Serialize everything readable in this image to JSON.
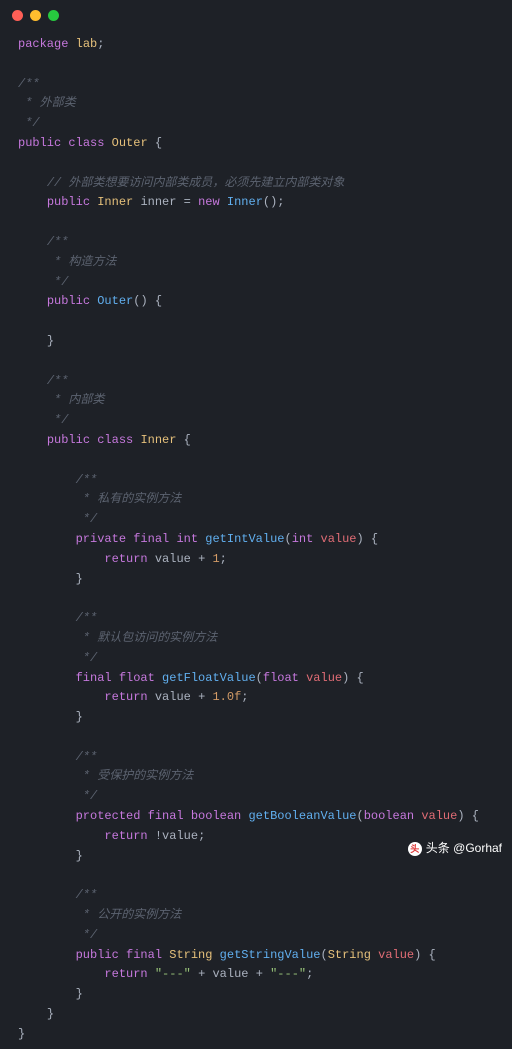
{
  "c": {
    "sc": ";",
    "ob": "{",
    "cb": "}",
    "op": "(",
    "eq": "=",
    "pl": "+",
    "ret": "return",
    "l0": {
      "a": "package",
      "b": "lab"
    },
    "c1": {
      "a": "/**",
      "b": " * 外部类",
      "c": " */"
    },
    "l1": {
      "a": "public",
      "b": "class",
      "c": "Outer"
    },
    "c2": "// 外部类想要访问内部类成员，必须先建立内部类对象",
    "l2": {
      "a": "public",
      "b": "Inner",
      "c": "inner",
      "d": "new",
      "e": "Inner",
      "f": "();"
    },
    "c3": {
      "a": "/**",
      "b": " * 构造方法",
      "c": " */"
    },
    "l3": {
      "a": "public",
      "b": "Outer",
      "c": "() {"
    },
    "c4": {
      "a": "/**",
      "b": " * 内部类",
      "c": " */"
    },
    "l4": {
      "a": "public",
      "b": "class",
      "c": "Inner"
    },
    "c5": {
      "a": "/**",
      "b": " * 私有的实例方法",
      "c": " */"
    },
    "l5": {
      "a": "private",
      "b": "final",
      "c": "int",
      "d": "getIntValue",
      "e": "int",
      "f": "value",
      "g": ") {",
      "h": "value",
      "i": "1"
    },
    "c6": {
      "a": "/**",
      "b": " * 默认包访问的实例方法",
      "c": " */"
    },
    "l6": {
      "a": "final",
      "b": "float",
      "c": "getFloatValue",
      "d": "float",
      "e": "value",
      "f": ") {",
      "g": "value",
      "h": "1.0f"
    },
    "c7": {
      "a": "/**",
      "b": " * 受保护的实例方法",
      "c": " */"
    },
    "l7": {
      "a": "protected",
      "b": "final",
      "c": "boolean",
      "d": "getBooleanValue",
      "e": "boolean",
      "f": "value",
      "g": ") {",
      "h": "!",
      "i": "value"
    },
    "c8": {
      "a": "/**",
      "b": " * 公开的实例方法",
      "c": " */"
    },
    "l8": {
      "a": "public",
      "b": "final",
      "c": "String",
      "d": "getStringValue",
      "e": "String",
      "f": "value",
      "g": ") {",
      "h": "\"---\"",
      "i": "value",
      "j": "\"---\""
    }
  },
  "wm": "头条 @Gorhaf"
}
